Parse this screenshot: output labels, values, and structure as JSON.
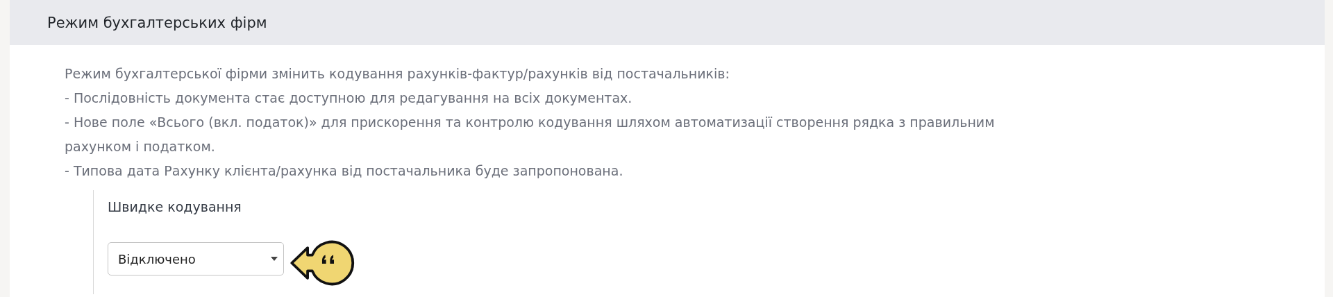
{
  "panel": {
    "title": "Режим бухгалтерських фірм",
    "description": [
      "Режим бухгалтерської фірми змінить кодування рахунків-фактур/рахунків від постачальників:",
      "- Послідовність документа стає доступною для редагування на всіх документах.",
      "- Нове поле «Всього (вкл. податок)» для прискорення та контролю кодування шляхом автоматизації створення рядка з правильним рахунком і податком.",
      "- Типова дата Рахунку клієнта/рахунка від постачальника буде запропонована."
    ],
    "setting": {
      "label": "Швидке кодування",
      "value": "Відключено"
    }
  }
}
